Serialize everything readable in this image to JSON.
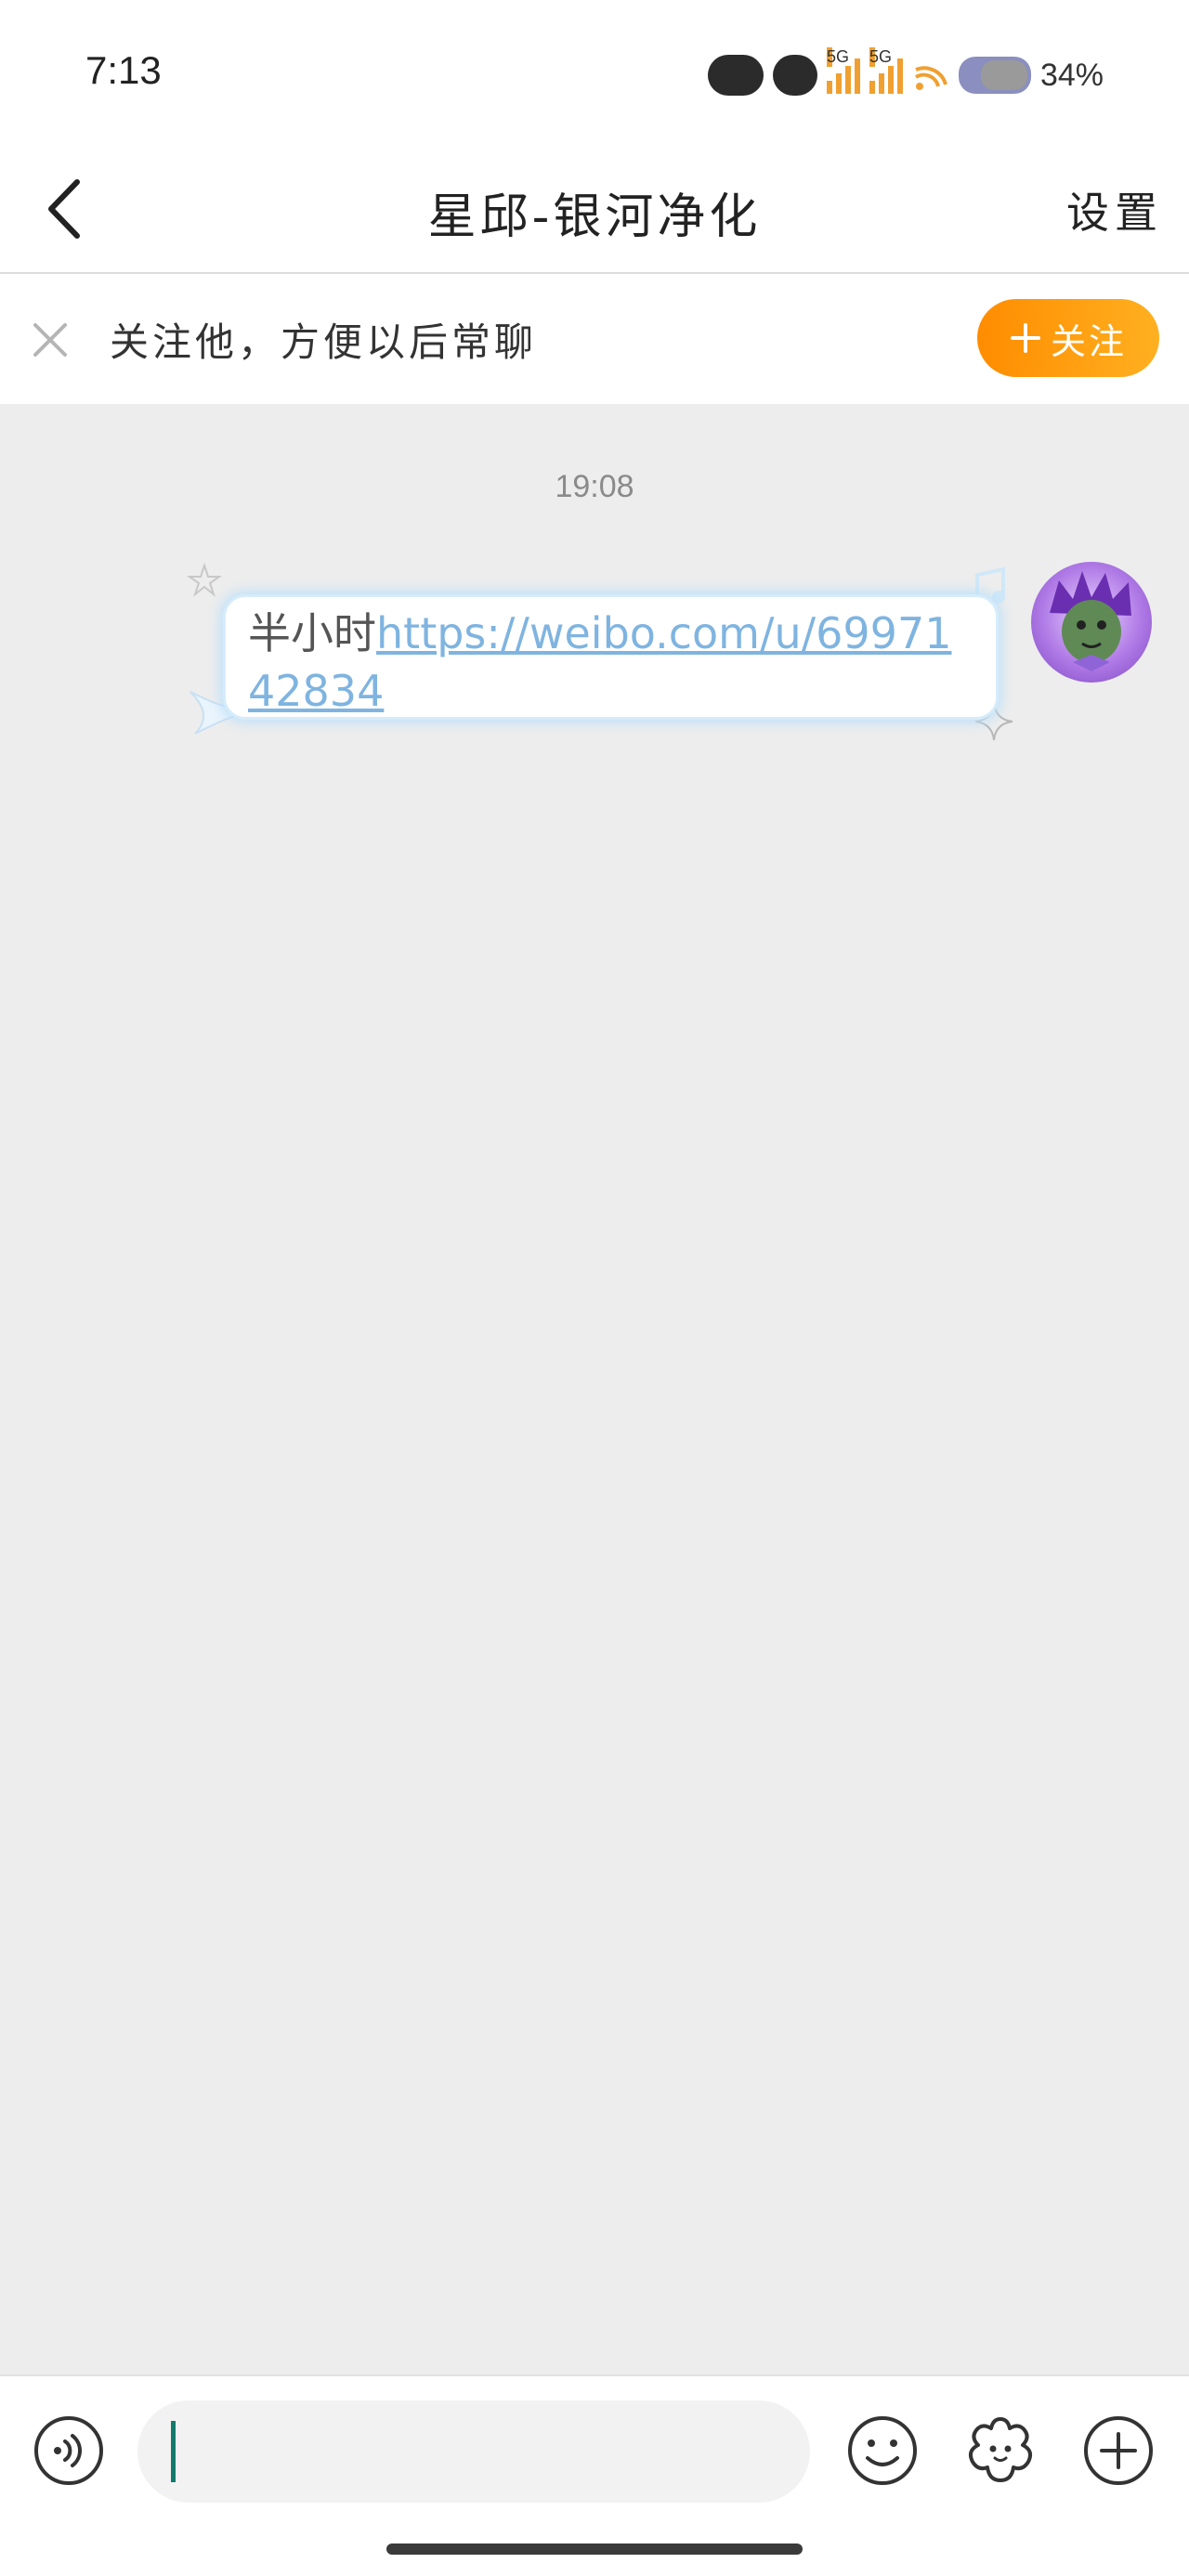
{
  "status_bar": {
    "time": "7:13",
    "battery": "34%",
    "network_1": "5G",
    "network_2": "5G"
  },
  "header": {
    "title": "星邱-银河净化",
    "settings_label": "设置"
  },
  "follow_banner": {
    "text": "关注他，方便以后常聊",
    "button_label": "关注",
    "button_icon": "plus-icon"
  },
  "chat": {
    "timestamp": "19:08",
    "messages": [
      {
        "sender": "self",
        "text": "半小时",
        "link": "https://weibo.com/u/6997142834"
      }
    ]
  },
  "input_bar": {
    "placeholder": "",
    "icons": [
      "voice-icon",
      "emoji-icon",
      "sticker-icon",
      "plus-icon"
    ]
  },
  "colors": {
    "accent": "#ff9a1a",
    "link": "#7fb4e0",
    "background": "#ededed"
  }
}
